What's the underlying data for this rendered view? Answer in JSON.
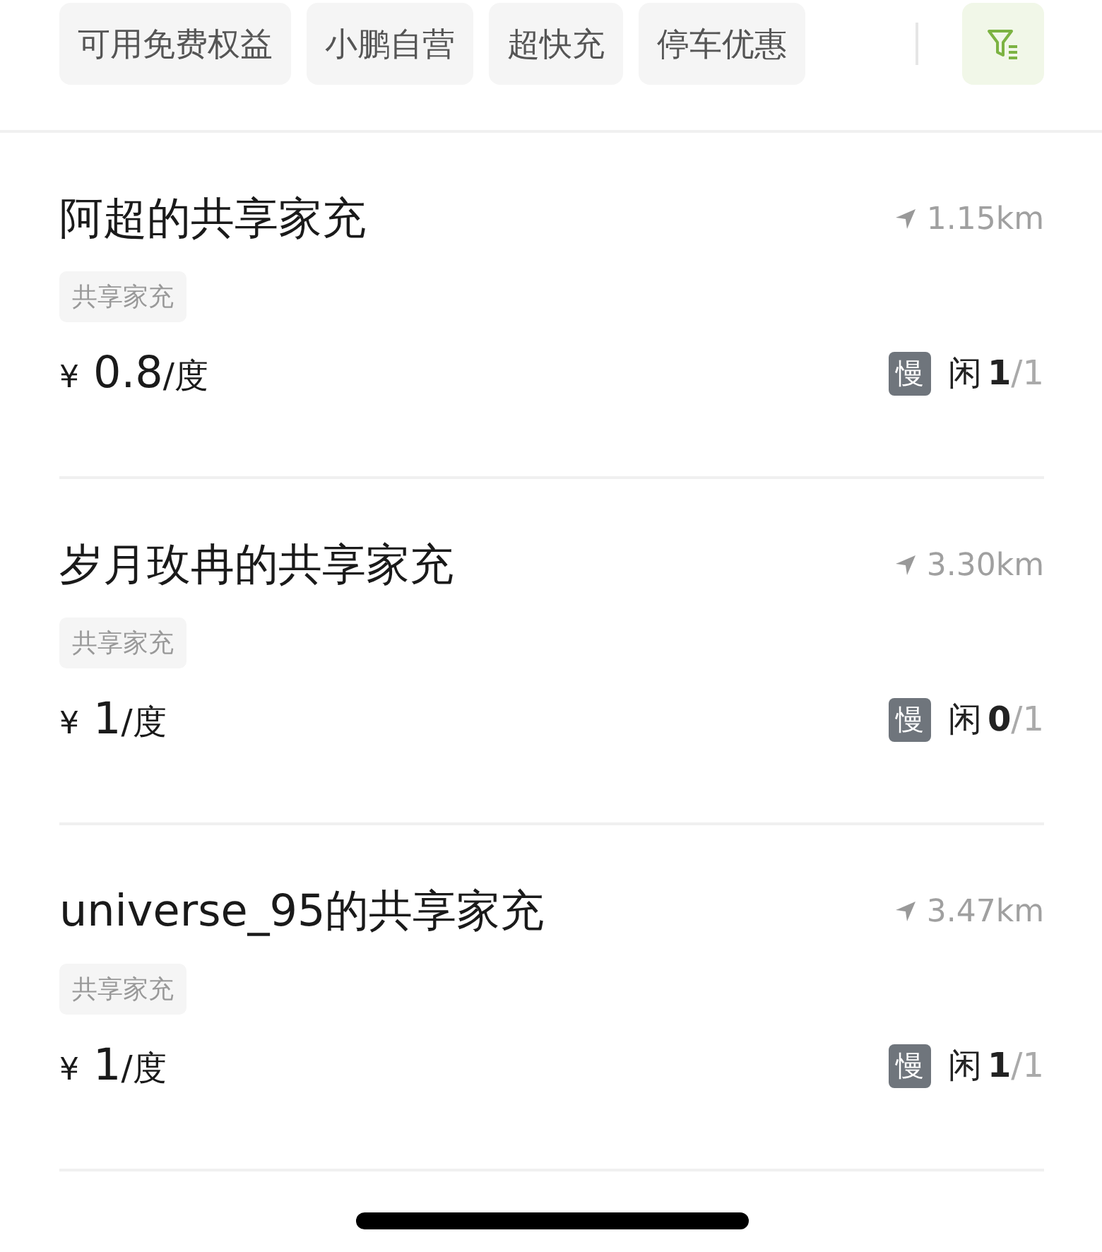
{
  "filters": [
    {
      "label": "可用免费权益"
    },
    {
      "label": "小鹏自营"
    },
    {
      "label": "超快充"
    },
    {
      "label": "停车优惠"
    }
  ],
  "stations": [
    {
      "name": "阿超的共享家充",
      "distance": "1.15km",
      "tag": "共享家充",
      "currency": "¥",
      "price": "0.8",
      "unit": "/度",
      "speed": "慢",
      "idle_label": "闲",
      "idle": "1",
      "total": "/1"
    },
    {
      "name": "岁月玫冉的共享家充",
      "distance": "3.30km",
      "tag": "共享家充",
      "currency": "¥",
      "price": "1",
      "unit": "/度",
      "speed": "慢",
      "idle_label": "闲",
      "idle": "0",
      "total": "/1"
    },
    {
      "name": "universe_95的共享家充",
      "distance": "3.47km",
      "tag": "共享家充",
      "currency": "¥",
      "price": "1",
      "unit": "/度",
      "speed": "慢",
      "idle_label": "闲",
      "idle": "1",
      "total": "/1"
    }
  ]
}
